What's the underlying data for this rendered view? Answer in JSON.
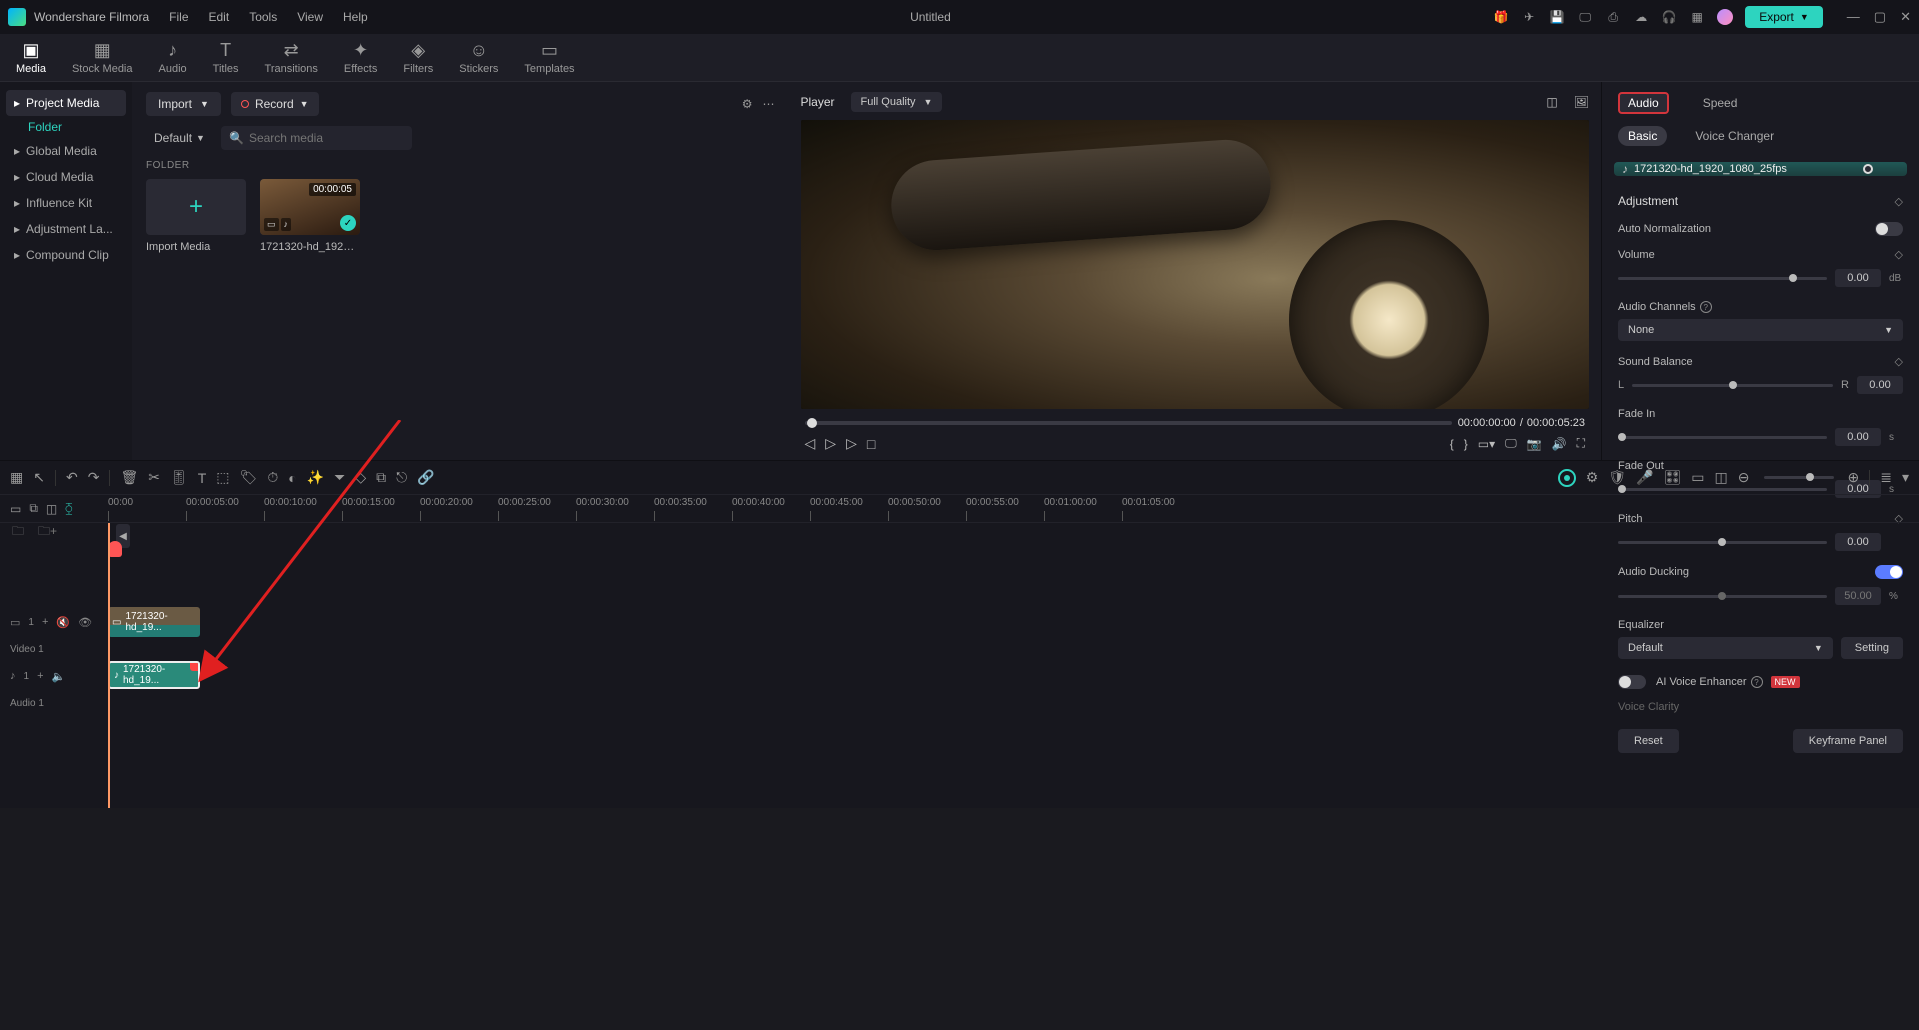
{
  "app": {
    "name": "Wondershare Filmora",
    "title": "Untitled"
  },
  "menu": [
    "File",
    "Edit",
    "Tools",
    "View",
    "Help"
  ],
  "export_label": "Export",
  "top_tabs": [
    {
      "label": "Media",
      "active": true
    },
    {
      "label": "Stock Media"
    },
    {
      "label": "Audio"
    },
    {
      "label": "Titles"
    },
    {
      "label": "Transitions"
    },
    {
      "label": "Effects"
    },
    {
      "label": "Filters"
    },
    {
      "label": "Stickers"
    },
    {
      "label": "Templates"
    }
  ],
  "sidebar": {
    "items": [
      "Project Media",
      "Global Media",
      "Cloud Media",
      "Influence Kit",
      "Adjustment La...",
      "Compound Clip"
    ],
    "sub": "Folder"
  },
  "media_panel": {
    "import_label": "Import",
    "record_label": "Record",
    "sort_label": "Default",
    "search_placeholder": "Search media",
    "folder_label": "FOLDER",
    "cards": [
      {
        "name": "Import Media",
        "is_add": true
      },
      {
        "name": "1721320-hd_1920_108...",
        "duration": "00:00:05"
      }
    ]
  },
  "preview": {
    "player_label": "Player",
    "quality": "Full Quality",
    "time_cur": "00:00:00:00",
    "time_sep": "/",
    "time_dur": "00:00:05:23"
  },
  "inspector": {
    "tabs": {
      "audio": "Audio",
      "speed": "Speed"
    },
    "subtabs": {
      "basic": "Basic",
      "voice": "Voice Changer"
    },
    "clip_name": "1721320-hd_1920_1080_25fps",
    "adjustment": "Adjustment",
    "auto_norm": "Auto Normalization",
    "volume": "Volume",
    "volume_val": "0.00",
    "volume_unit": "dB",
    "channels": "Audio Channels",
    "channels_sel": "None",
    "balance": "Sound Balance",
    "bal_l": "L",
    "bal_r": "R",
    "bal_val": "0.00",
    "fadein": "Fade In",
    "fadein_val": "0.00",
    "sec": "s",
    "fadeout": "Fade Out",
    "fadeout_val": "0.00",
    "pitch": "Pitch",
    "pitch_val": "0.00",
    "ducking": "Audio Ducking",
    "duck_val": "50.00",
    "duck_unit": "%",
    "eq": "Equalizer",
    "eq_sel": "Default",
    "eq_btn": "Setting",
    "voice_enh": "AI Voice Enhancer",
    "new": "NEW",
    "clarity": "Voice Clarity",
    "reset": "Reset",
    "keyframe": "Keyframe Panel"
  },
  "timeline": {
    "ticks": [
      "00:00",
      "00:00:05:00",
      "00:00:10:00",
      "00:00:15:00",
      "00:00:20:00",
      "00:00:25:00",
      "00:00:30:00",
      "00:00:35:00",
      "00:00:40:00",
      "00:00:45:00",
      "00:00:50:00",
      "00:00:55:00",
      "00:01:00:00",
      "00:01:05:00"
    ],
    "video_track": {
      "num": "1",
      "label": "Video 1"
    },
    "audio_track": {
      "num": "1",
      "label": "Audio 1"
    },
    "video_clip": "1721320-hd_19...",
    "audio_clip": "1721320-hd_19..."
  }
}
